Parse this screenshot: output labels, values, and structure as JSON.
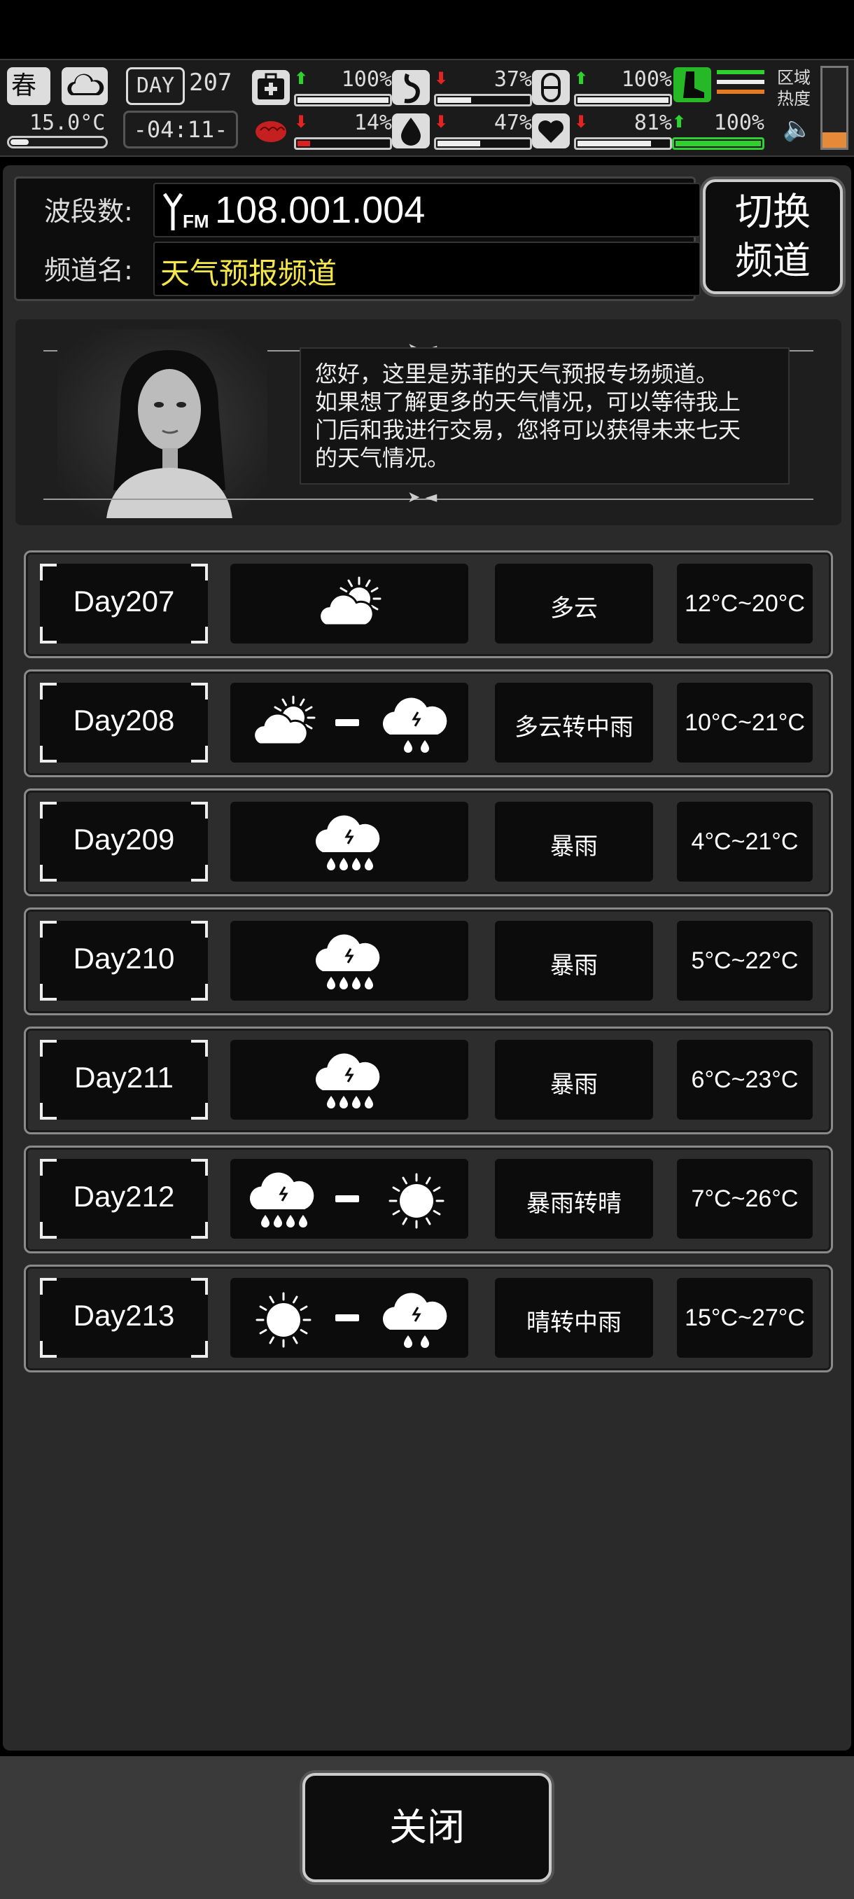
{
  "hud": {
    "season": "春",
    "temperature": "15.0°C",
    "day_label": "DAY",
    "day_number": "207",
    "clock": "-04:11-",
    "stats": [
      {
        "icon": "medkit-icon",
        "trend": "up",
        "value": "100%",
        "level": 1.0
      },
      {
        "icon": "stomach-icon",
        "trend": "down",
        "value": "37%",
        "level": 0.37
      },
      {
        "icon": "capsule-icon",
        "trend": "up",
        "value": "100%",
        "level": 1.0
      },
      {
        "icon": "brain-icon",
        "trend": "down",
        "value": "14%",
        "level": 0.14
      },
      {
        "icon": "water-drop-icon",
        "trend": "down",
        "value": "47%",
        "level": 0.47
      },
      {
        "icon": "heart-icon",
        "trend": "down",
        "value": "81%",
        "level": 0.81
      }
    ],
    "stamina": {
      "trend": "up",
      "value": "100%",
      "level": 1.0
    },
    "region_label_1": "区域",
    "region_label_2": "热度",
    "heat_level": 0.2
  },
  "radio": {
    "band_label": "波段数:",
    "band_icon": "fm-antenna-icon",
    "band_value": "108.001.004",
    "channel_label": "频道名:",
    "channel_value": "天气预报频道",
    "switch_label_1": "切换",
    "switch_label_2": "频道"
  },
  "message": {
    "line1": "您好，这里是苏菲的天气预报专场频道。",
    "line2": "如果想了解更多的天气情况，可以等待我上",
    "line3": "门后和我进行交易，您将可以获得未来七天",
    "line4": "的天气情况。"
  },
  "forecast": [
    {
      "day": "Day207",
      "icons": [
        "partly-cloudy-icon"
      ],
      "desc": "多云",
      "temp": "12°C~20°C"
    },
    {
      "day": "Day208",
      "icons": [
        "partly-cloudy-icon",
        "moderate-rain-icon"
      ],
      "desc": "多云转中雨",
      "temp": "10°C~21°C"
    },
    {
      "day": "Day209",
      "icons": [
        "heavy-rain-icon"
      ],
      "desc": "暴雨",
      "temp": "4°C~21°C"
    },
    {
      "day": "Day210",
      "icons": [
        "heavy-rain-icon"
      ],
      "desc": "暴雨",
      "temp": "5°C~22°C"
    },
    {
      "day": "Day211",
      "icons": [
        "heavy-rain-icon"
      ],
      "desc": "暴雨",
      "temp": "6°C~23°C"
    },
    {
      "day": "Day212",
      "icons": [
        "heavy-rain-icon",
        "sunny-icon"
      ],
      "desc": "暴雨转晴",
      "temp": "7°C~26°C"
    },
    {
      "day": "Day213",
      "icons": [
        "sunny-icon",
        "moderate-rain-icon"
      ],
      "desc": "晴转中雨",
      "temp": "15°C~27°C"
    }
  ],
  "footer": {
    "close_label": "关闭"
  }
}
